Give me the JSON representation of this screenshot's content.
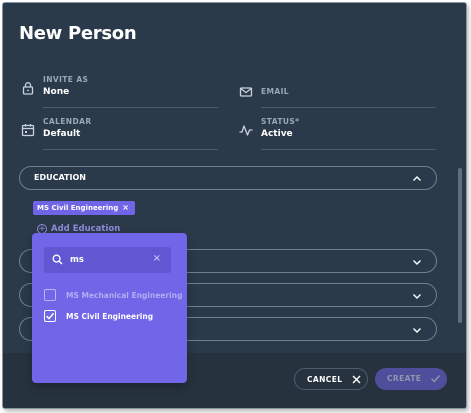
{
  "window": {
    "title": "New Person"
  },
  "fields": {
    "invite_as": {
      "label": "INVITE AS",
      "value": "None",
      "icon": "lock-icon"
    },
    "email": {
      "label": "EMAIL",
      "value": "",
      "icon": "envelope-icon"
    },
    "calendar": {
      "label": "CALENDAR",
      "value": "Default",
      "icon": "calendar-icon"
    },
    "status": {
      "label": "STATUS*",
      "value": "Active",
      "icon": "pulse-icon"
    }
  },
  "education": {
    "label": "EDUCATION",
    "chip": "MS Civil Engineering",
    "chip_remove": "×",
    "add_label": "Add Education"
  },
  "dropdown": {
    "search_value": "ms",
    "clear": "×",
    "options": [
      {
        "label": "MS Mechanical Engineering",
        "checked": false
      },
      {
        "label": "MS Civil Engineering",
        "checked": true
      }
    ]
  },
  "footer": {
    "cancel_label": "CANCEL",
    "create_label": "CREATE"
  },
  "colors": {
    "background": "#2b3a4b",
    "accent": "#7165e8",
    "muted": "#9aa7b6"
  }
}
